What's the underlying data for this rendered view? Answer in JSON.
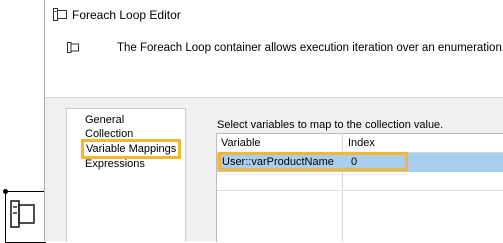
{
  "dialog": {
    "title": "Foreach Loop Editor",
    "description": "The Foreach Loop container allows execution iteration over an enumeration."
  },
  "nav": {
    "items": [
      {
        "label": "General"
      },
      {
        "label": "Collection"
      },
      {
        "label": "Variable Mappings",
        "selected": true
      },
      {
        "label": "Expressions"
      }
    ]
  },
  "mappings": {
    "prompt": "Select variables to map to the collection value.",
    "columns": [
      "Variable",
      "Index"
    ],
    "rows": [
      {
        "variable": "User::varProductName",
        "index": "0"
      }
    ]
  },
  "colors": {
    "highlight": "#f5b82e",
    "selected_row": "#a8cff0"
  },
  "icons": [
    "foreach-loop-icon"
  ]
}
